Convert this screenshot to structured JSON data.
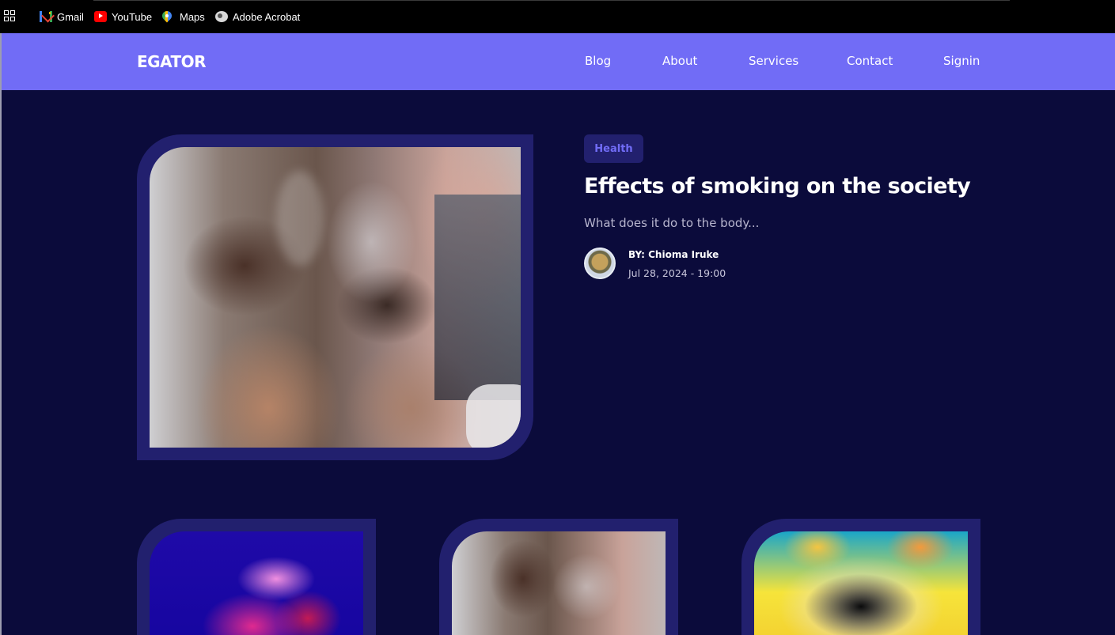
{
  "bookmarks": [
    {
      "label": "Gmail",
      "icon": "gmail-icon"
    },
    {
      "label": "YouTube",
      "icon": "youtube-icon"
    },
    {
      "label": "Maps",
      "icon": "maps-icon"
    },
    {
      "label": "Adobe Acrobat",
      "icon": "globe-icon"
    }
  ],
  "nav": {
    "logo": "EGATOR",
    "links": [
      "Blog",
      "About",
      "Services",
      "Contact",
      "Signin"
    ]
  },
  "featured": {
    "tag": "Health",
    "title": "Effects of smoking on the society",
    "subtitle": "What does it do to the body...",
    "author": "BY: Chioma Iruke",
    "date": "Jul 28, 2024 - 19:00"
  },
  "colors": {
    "nav_bg": "#716cf6",
    "page_bg": "#0b0b3b",
    "frame": "#22206e",
    "accent": "#716cf6"
  }
}
